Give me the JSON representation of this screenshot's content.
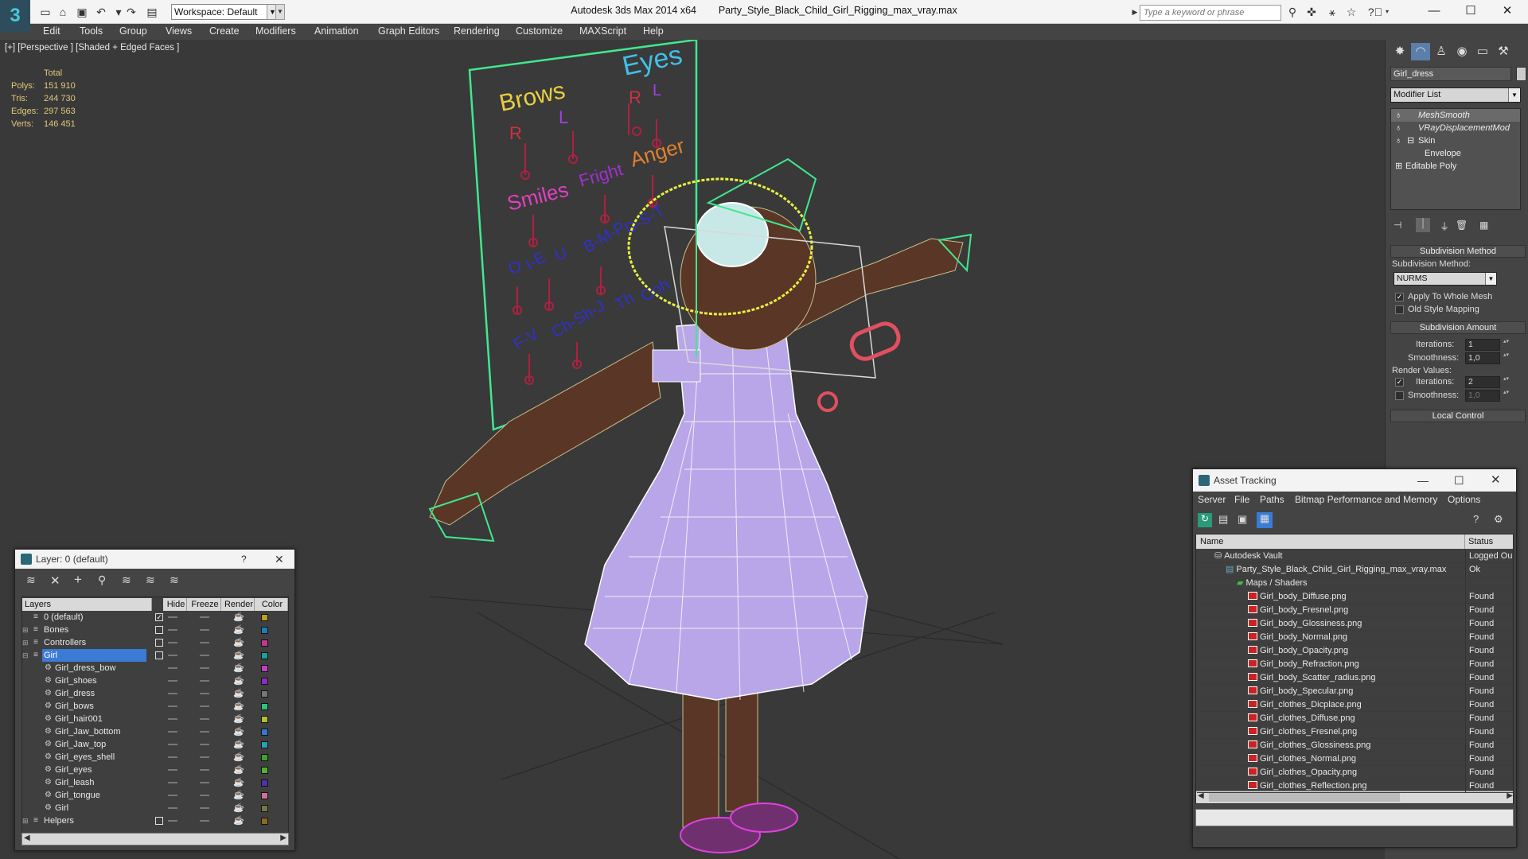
{
  "titlebar": {
    "workspace": "Workspace: Default",
    "app": "Autodesk 3ds Max  2014 x64",
    "file": "Party_Style_Black_Child_Girl_Rigging_max_vray.max",
    "search_placeholder": "Type a keyword or phrase"
  },
  "menu": [
    "Edit",
    "Tools",
    "Group",
    "Views",
    "Create",
    "Modifiers",
    "Animation",
    "Graph Editors",
    "Rendering",
    "Customize",
    "MAXScript",
    "Help"
  ],
  "viewport": {
    "label": "[+] [Perspective ] [Shaded + Edged Faces ]",
    "stats_total": "Total",
    "stats": [
      {
        "k": "Polys:",
        "v": "151 910"
      },
      {
        "k": "Tris:",
        "v": "244 730"
      },
      {
        "k": "Edges:",
        "v": "297 563"
      },
      {
        "k": "Verts:",
        "v": "146 451"
      }
    ],
    "board": {
      "brows": "Brows",
      "eyes": "Eyes",
      "r": "R",
      "l": "L",
      "smiles": "Smiles",
      "fright": "Fright",
      "anger": "Anger",
      "visemes": [
        "O",
        "I-E",
        "U",
        "B-M-P",
        "D-S-T"
      ],
      "visemes2": [
        "F-V",
        "Ch-Sh-J",
        "Th",
        "Ooh"
      ]
    }
  },
  "cmdpanel": {
    "object_name": "Girl_dress",
    "modifier_list": "Modifier List",
    "stack": [
      "MeshSmooth",
      "VRayDisplacementMod",
      "Skin",
      "Envelope",
      "Editable Poly"
    ],
    "subdiv_method_hdr": "Subdivision Method",
    "subdiv_method_label": "Subdivision Method:",
    "subdiv_method_value": "NURMS",
    "apply_whole": "Apply To Whole Mesh",
    "old_style": "Old Style Mapping",
    "subdiv_amount_hdr": "Subdivision Amount",
    "iterations_label": "Iterations:",
    "iterations": "1",
    "smoothness_label": "Smoothness:",
    "smoothness": "1,0",
    "render_values": "Render Values:",
    "r_iterations": "2",
    "r_smoothness": "1,0",
    "local_control_hdr": "Local Control"
  },
  "layers": {
    "title": "Layer: 0 (default)",
    "help": "?",
    "cols": {
      "layers": "Layers",
      "hide": "Hide",
      "freeze": "Freeze",
      "render": "Render",
      "color": "Color"
    },
    "rows": [
      {
        "name": "0 (default)",
        "indent": 0,
        "color": "#b8a020",
        "check": "✓"
      },
      {
        "name": "Bones",
        "indent": 0,
        "color": "#1c7fb0",
        "check": ""
      },
      {
        "name": "Controllers",
        "indent": 0,
        "color": "#c23a8a",
        "check": ""
      },
      {
        "name": "Girl",
        "indent": 0,
        "color": "#18a09a",
        "check": "",
        "sel": true
      },
      {
        "name": "Girl_dress_bow",
        "indent": 1,
        "color": "#c040c0",
        "check": ""
      },
      {
        "name": "Girl_shoes",
        "indent": 1,
        "color": "#8a2cc0",
        "check": ""
      },
      {
        "name": "Girl_dress",
        "indent": 1,
        "color": "#777777",
        "check": ""
      },
      {
        "name": "Girl_bows",
        "indent": 1,
        "color": "#30c080",
        "check": ""
      },
      {
        "name": "Girl_hair001",
        "indent": 1,
        "color": "#b0c030",
        "check": ""
      },
      {
        "name": "Girl_Jaw_bottom",
        "indent": 1,
        "color": "#3078d0",
        "check": ""
      },
      {
        "name": "Girl_Jaw_top",
        "indent": 1,
        "color": "#2aa0b0",
        "check": ""
      },
      {
        "name": "Girl_eyes_shell",
        "indent": 1,
        "color": "#40a030",
        "check": ""
      },
      {
        "name": "Girl_eyes",
        "indent": 1,
        "color": "#50b030",
        "check": ""
      },
      {
        "name": "Girl_leash",
        "indent": 1,
        "color": "#5030b0",
        "check": ""
      },
      {
        "name": "Girl_tongue",
        "indent": 1,
        "color": "#d0709a",
        "check": ""
      },
      {
        "name": "Girl",
        "indent": 1,
        "color": "#777744",
        "check": ""
      },
      {
        "name": "Helpers",
        "indent": 0,
        "color": "#8a6a20",
        "check": ""
      }
    ]
  },
  "assets": {
    "title": "Asset Tracking",
    "menu": [
      "Server",
      "File",
      "Paths",
      "Bitmap Performance and Memory",
      "Options"
    ],
    "col_name": "Name",
    "col_status": "Status",
    "rows": [
      {
        "name": "Autodesk Vault",
        "status": "Logged Ou",
        "indent": 1,
        "kind": "vault"
      },
      {
        "name": "Party_Style_Black_Child_Girl_Rigging_max_vray.max",
        "status": "Ok",
        "indent": 2,
        "kind": "max"
      },
      {
        "name": "Maps / Shaders",
        "status": "",
        "indent": 3,
        "kind": "folder"
      },
      {
        "name": "Girl_body_Diffuse.png",
        "status": "Found",
        "indent": 4,
        "kind": "png"
      },
      {
        "name": "Girl_body_Fresnel.png",
        "status": "Found",
        "indent": 4,
        "kind": "png"
      },
      {
        "name": "Girl_body_Glossiness.png",
        "status": "Found",
        "indent": 4,
        "kind": "png"
      },
      {
        "name": "Girl_body_Normal.png",
        "status": "Found",
        "indent": 4,
        "kind": "png"
      },
      {
        "name": "Girl_body_Opacity.png",
        "status": "Found",
        "indent": 4,
        "kind": "png"
      },
      {
        "name": "Girl_body_Refraction.png",
        "status": "Found",
        "indent": 4,
        "kind": "png"
      },
      {
        "name": "Girl_body_Scatter_radius.png",
        "status": "Found",
        "indent": 4,
        "kind": "png"
      },
      {
        "name": "Girl_body_Specular.png",
        "status": "Found",
        "indent": 4,
        "kind": "png"
      },
      {
        "name": "Girl_clothes_Dicplace.png",
        "status": "Found",
        "indent": 4,
        "kind": "png"
      },
      {
        "name": "Girl_clothes_Diffuse.png",
        "status": "Found",
        "indent": 4,
        "kind": "png"
      },
      {
        "name": "Girl_clothes_Fresnel.png",
        "status": "Found",
        "indent": 4,
        "kind": "png"
      },
      {
        "name": "Girl_clothes_Glossiness.png",
        "status": "Found",
        "indent": 4,
        "kind": "png"
      },
      {
        "name": "Girl_clothes_Normal.png",
        "status": "Found",
        "indent": 4,
        "kind": "png"
      },
      {
        "name": "Girl_clothes_Opacity.png",
        "status": "Found",
        "indent": 4,
        "kind": "png"
      },
      {
        "name": "Girl_clothes_Reflection.png",
        "status": "Found",
        "indent": 4,
        "kind": "png"
      }
    ]
  }
}
